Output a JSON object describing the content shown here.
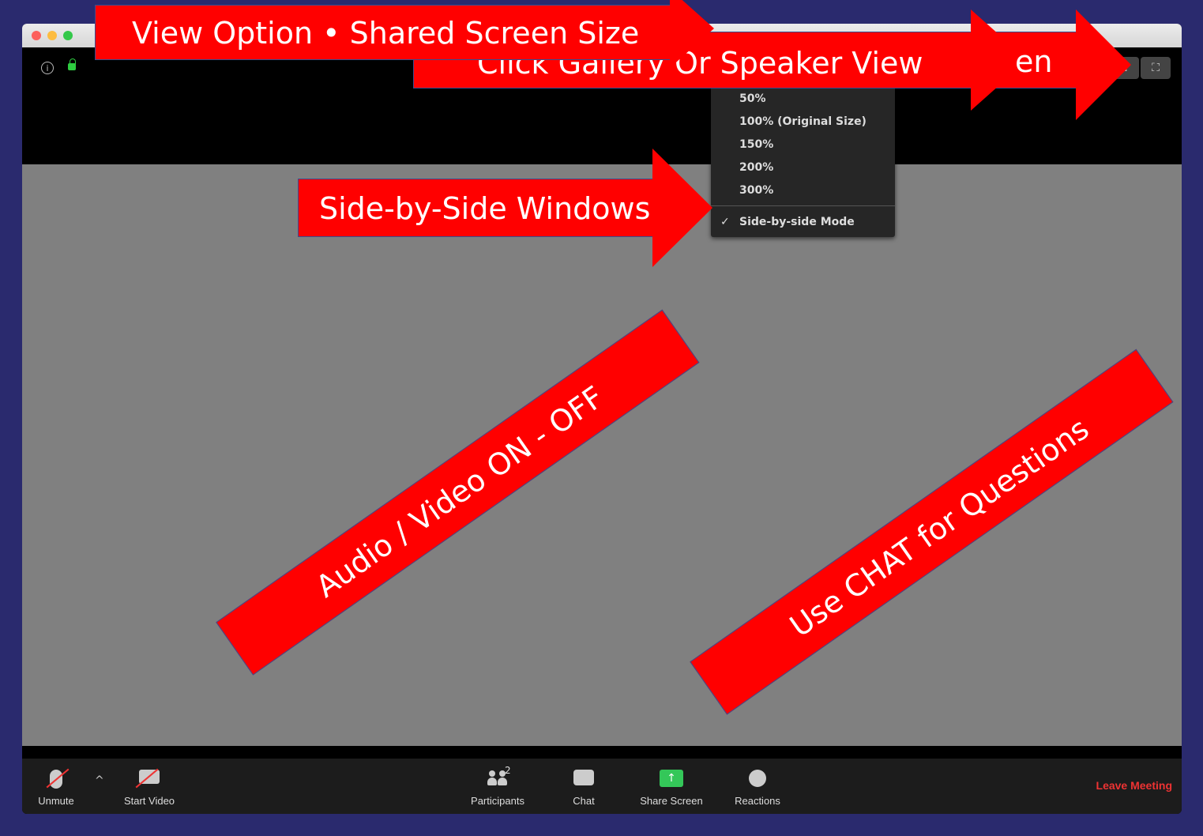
{
  "window": {
    "title": ""
  },
  "view_menu": {
    "items": [
      "50%",
      "100% (Original Size)",
      "150%",
      "200%",
      "300%"
    ],
    "checked_item_label": "Side-by-side Mode",
    "check_mark": "✓"
  },
  "toolbar": {
    "unmute_label": "Unmute",
    "start_video_label": "Start Video",
    "participants_label": "Participants",
    "participants_count": "2",
    "chat_label": "Chat",
    "share_screen_label": "Share Screen",
    "reactions_label": "Reactions",
    "leave_label": "Leave Meeting"
  },
  "annotations": {
    "view_option": "View Option • Shared Screen Size",
    "gallery_view": "Click Gallery Or Speaker  View",
    "fullscreen_partial": "en",
    "side_by_side": "Side-by-Side Windows",
    "audio_video": "Audio / Video  ON - OFF",
    "chat_questions": "Use CHAT for Questions"
  },
  "colors": {
    "callout_red": "#ff0000",
    "share_green": "#34c759",
    "leave_red": "#e33333",
    "background_navy": "#2a2a6e"
  }
}
